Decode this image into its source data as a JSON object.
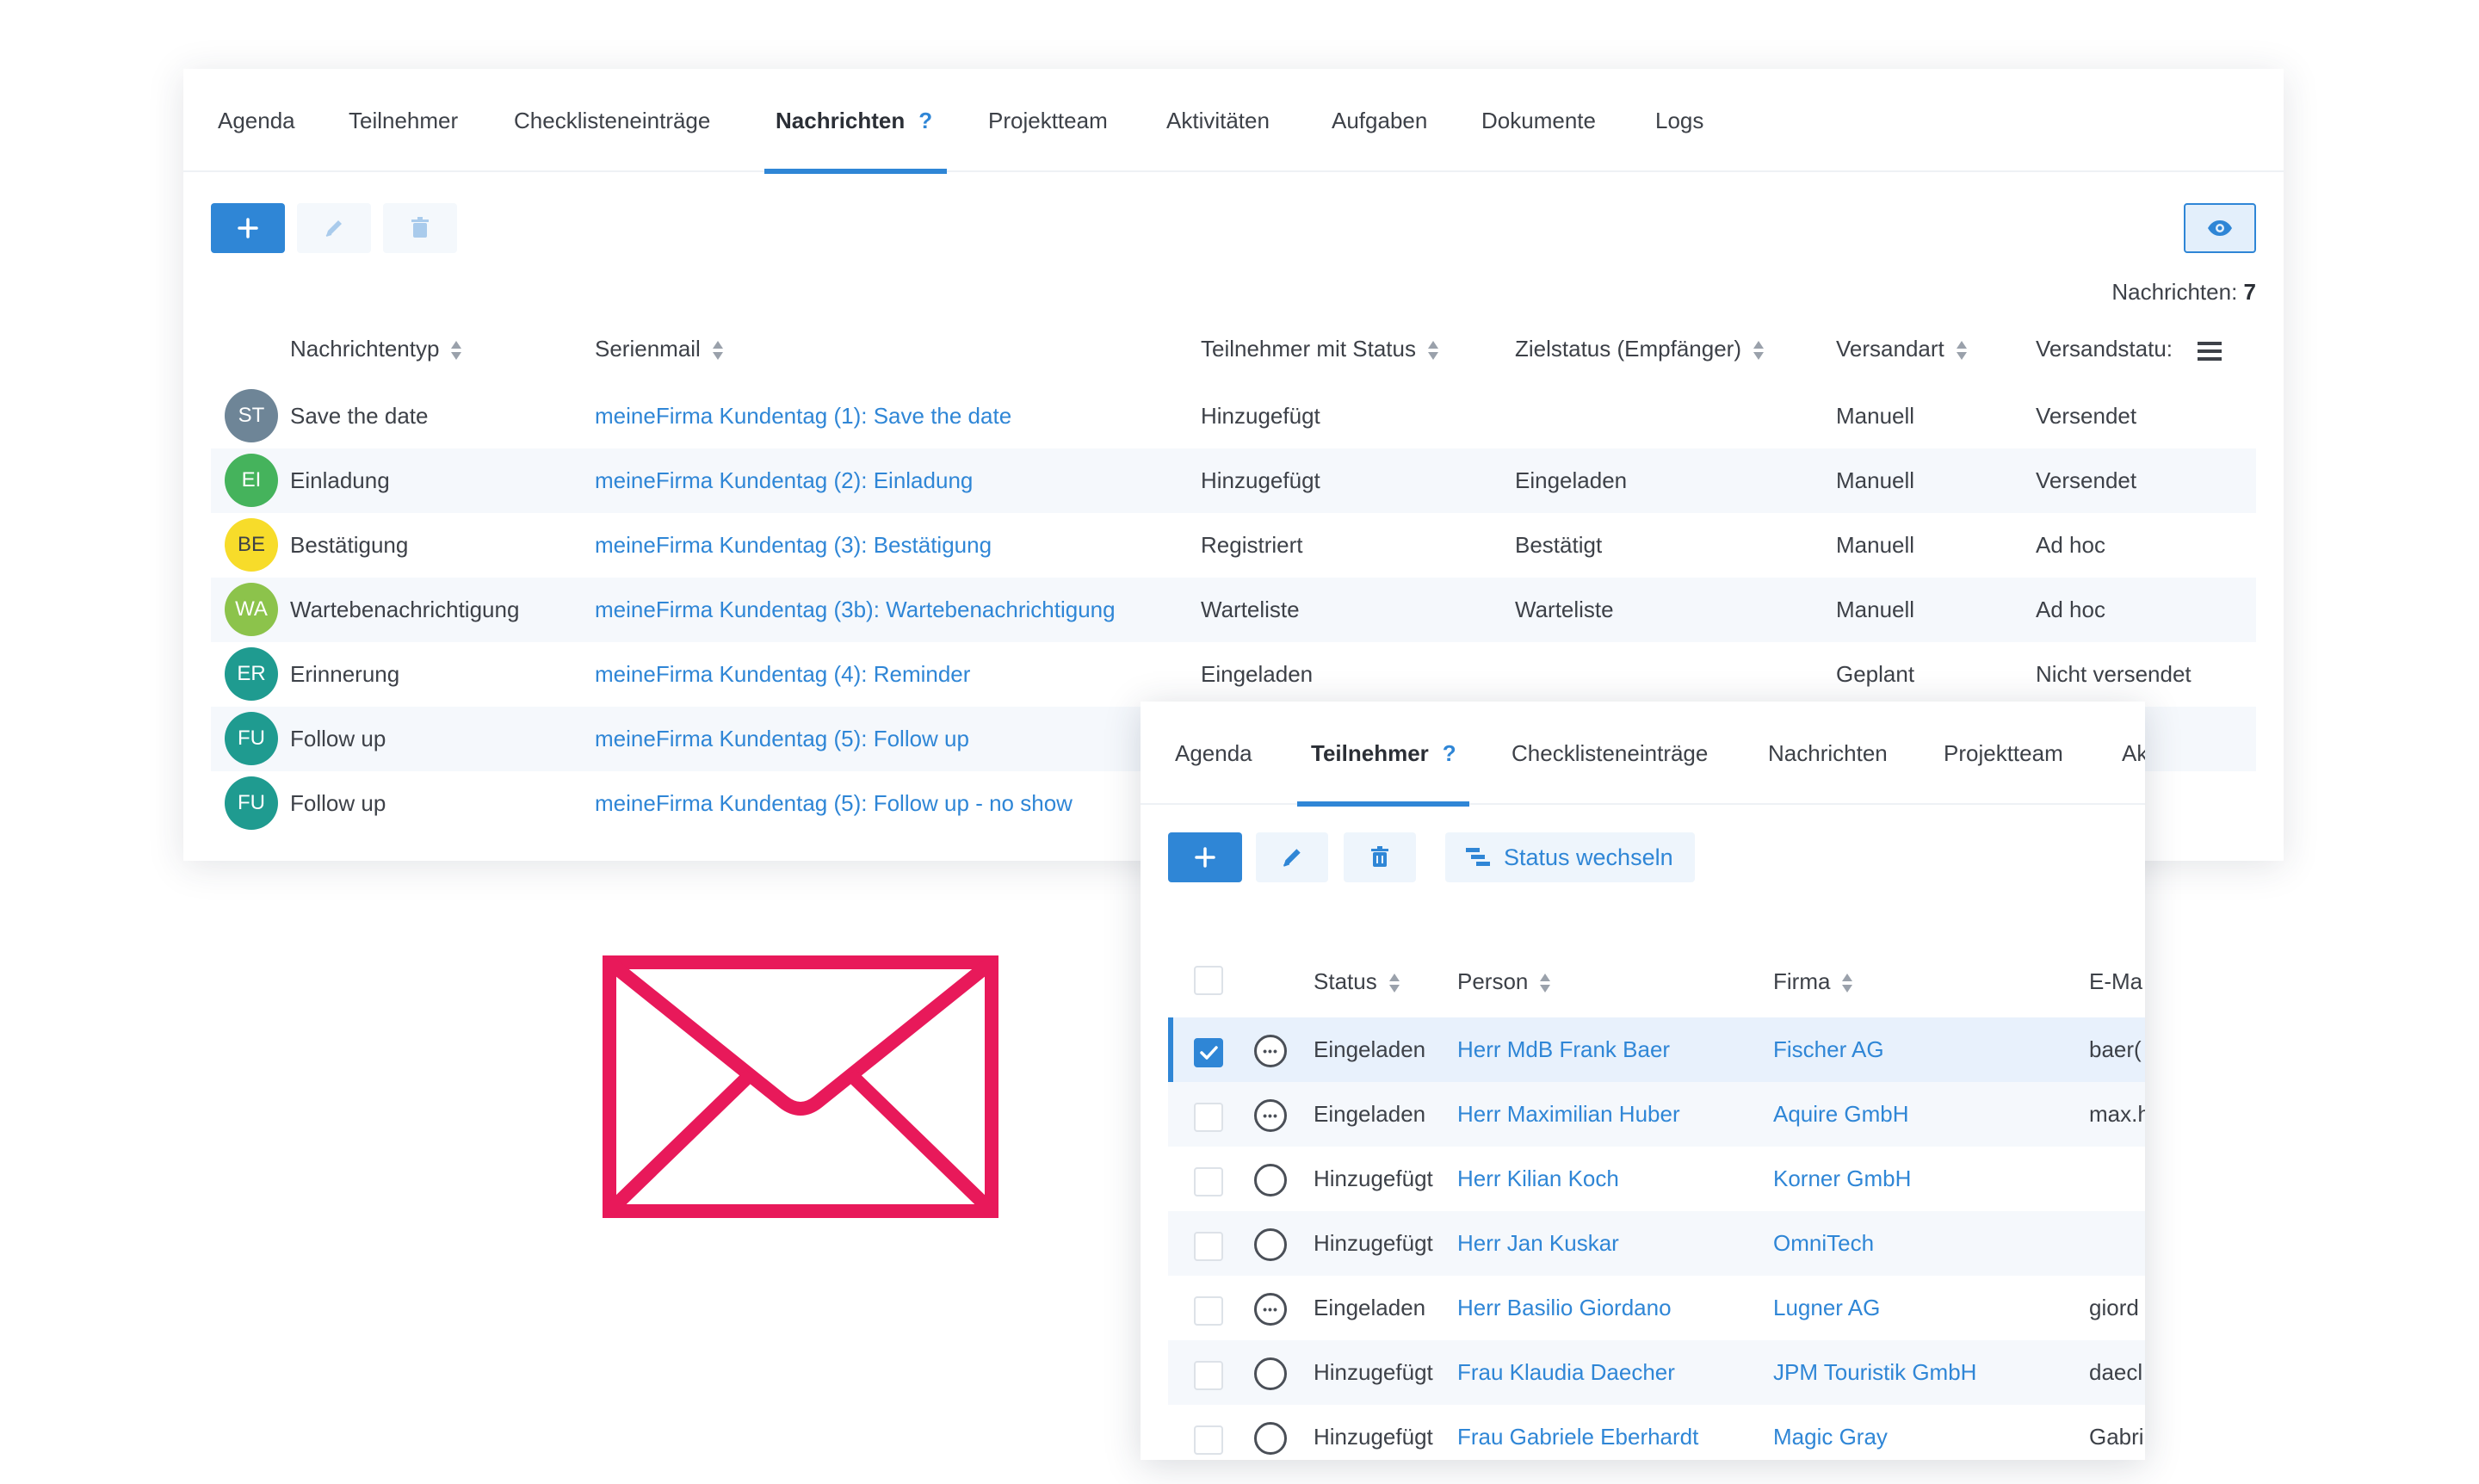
{
  "panel1": {
    "tabs": [
      {
        "label": "Agenda"
      },
      {
        "label": "Teilnehmer"
      },
      {
        "label": "Checklisteneinträge"
      },
      {
        "label": "Nachrichten",
        "help": "?"
      },
      {
        "label": "Projektteam"
      },
      {
        "label": "Aktivitäten"
      },
      {
        "label": "Aufgaben"
      },
      {
        "label": "Dokumente"
      },
      {
        "label": "Logs"
      }
    ],
    "active_tab": "Nachrichten",
    "toolbar": {
      "add": "+",
      "edit": "edit-icon",
      "delete": "trash-icon",
      "view": "eye-icon"
    },
    "count_label": "Nachrichten:",
    "count_value": "7",
    "columns": [
      "Nachrichtentyp",
      "Serienmail",
      "Teilnehmer mit Status",
      "Zielstatus (Empfänger)",
      "Versandart",
      "Versandstatu:"
    ],
    "rows": [
      {
        "initials": "ST",
        "color": "#6e8597",
        "type": "Save the date",
        "mail": "meineFirma Kundentag (1): Save the date",
        "status": "Hinzugefügt",
        "target": "",
        "mode": "Manuell",
        "send_status": "Versendet"
      },
      {
        "initials": "EI",
        "color": "#45b35c",
        "type": "Einladung",
        "mail": "meineFirma Kundentag (2): Einladung",
        "status": "Hinzugefügt",
        "target": "Eingeladen",
        "mode": "Manuell",
        "send_status": "Versendet"
      },
      {
        "initials": "BE",
        "color": "#f7dc2a",
        "type": "Bestätigung",
        "mail": "meineFirma Kundentag (3): Bestätigung",
        "status": "Registriert",
        "target": "Bestätigt",
        "mode": "Manuell",
        "send_status": "Ad hoc"
      },
      {
        "initials": "WA",
        "color": "#8cc34b",
        "type": "Wartebenachrichtigung",
        "mail": "meineFirma Kundentag (3b): Wartebenachrichtigung",
        "status": "Warteliste",
        "target": "Warteliste",
        "mode": "Manuell",
        "send_status": "Ad hoc"
      },
      {
        "initials": "ER",
        "color": "#1f9b90",
        "type": "Erinnerung",
        "mail": "meineFirma Kundentag (4): Reminder",
        "status": "Eingeladen",
        "target": "",
        "mode": "Geplant",
        "send_status": "Nicht versendet"
      },
      {
        "initials": "FU",
        "color": "#1f9b90",
        "type": "Follow up",
        "mail": "meineFirma Kundentag (5): Follow up",
        "status": "",
        "target": "",
        "mode": "",
        "send_status": "endet"
      },
      {
        "initials": "FU",
        "color": "#1f9b90",
        "type": "Follow up",
        "mail": "meineFirma Kundentag (5): Follow up - no show",
        "status": "",
        "target": "",
        "mode": "",
        "send_status": "endet"
      }
    ]
  },
  "envelope": {
    "icon": "envelope-icon",
    "color": "#e8195a"
  },
  "panel2": {
    "tabs": [
      {
        "label": "Agenda"
      },
      {
        "label": "Teilnehmer",
        "help": "?"
      },
      {
        "label": "Checklisteneinträge"
      },
      {
        "label": "Nachrichten"
      },
      {
        "label": "Projektteam"
      },
      {
        "label": "Ak"
      }
    ],
    "active_tab": "Teilnehmer",
    "status_button": "Status wechseln",
    "columns": [
      "Status",
      "Person",
      "Firma",
      "E-Ma"
    ],
    "rows": [
      {
        "checked": true,
        "icon": "dots-circle",
        "status": "Eingeladen",
        "person": "Herr MdB Frank Baer",
        "company": "Fischer AG",
        "email": "baer("
      },
      {
        "checked": false,
        "icon": "dots-circle",
        "status": "Eingeladen",
        "person": "Herr Maximilian Huber",
        "company": "Aquire GmbH",
        "email": "max.h"
      },
      {
        "checked": false,
        "icon": "empty-circle",
        "status": "Hinzugefügt",
        "person": "Herr Kilian Koch",
        "company": "Korner GmbH",
        "email": ""
      },
      {
        "checked": false,
        "icon": "empty-circle",
        "status": "Hinzugefügt",
        "person": "Herr Jan Kuskar",
        "company": "OmniTech",
        "email": ""
      },
      {
        "checked": false,
        "icon": "dots-circle",
        "status": "Eingeladen",
        "person": "Herr Basilio Giordano",
        "company": "Lugner AG",
        "email": "giord"
      },
      {
        "checked": false,
        "icon": "empty-circle",
        "status": "Hinzugefügt",
        "person": "Frau Klaudia Daecher",
        "company": "JPM Touristik GmbH",
        "email": "daecl"
      },
      {
        "checked": false,
        "icon": "empty-circle",
        "status": "Hinzugefügt",
        "person": "Frau Gabriele Eberhardt",
        "company": "Magic Gray",
        "email": "Gabri"
      }
    ]
  }
}
